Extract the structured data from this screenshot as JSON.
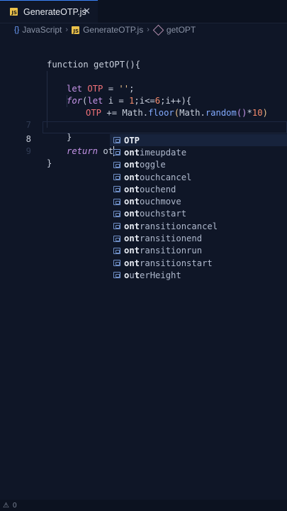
{
  "tab": {
    "label": "GenerateOTP.js",
    "badge": "JS",
    "close": "✕"
  },
  "breadcrumb": {
    "lang": "JavaScript",
    "file": "GenerateOTP.js",
    "symbol": "getOPT",
    "sep": "›"
  },
  "lines": [
    "7",
    "8",
    "9"
  ],
  "code": {
    "l2_kw": "function",
    "l2_fn": "getOPT",
    "l2_rest": "(){",
    "l4_kw": "let",
    "l4_var": "OTP",
    "l4_eq": " = ",
    "l4_str": "''",
    "l4_semi": ";",
    "l5_kw": "for",
    "l5_p1": "(",
    "l5_let": "let",
    "l5_p2": " i = ",
    "l5_n1": "1",
    "l5_p3": ";i<=",
    "l5_n2": "6",
    "l5_p4": ";i++){",
    "l6_var": "OTP",
    "l6_op": " += ",
    "l6_math1": "Math",
    "l6_dot1": ".",
    "l6_floor": "floor",
    "l6_paren": "(",
    "l6_math2": "Math",
    "l6_dot2": ".",
    "l6_random": "random",
    "l6_call": "()",
    "l6_times": "*",
    "l6_n": "10",
    "l6_close": ")",
    "l7_brace": "}",
    "l8_kw": "return",
    "l8_typed": " ot",
    "l9_brace": "}"
  },
  "suggestions": [
    {
      "match": "OTP",
      "rest": ""
    },
    {
      "match": "ont",
      "rest": "imeupdate"
    },
    {
      "match": "ont",
      "rest": "oggle"
    },
    {
      "match": "ont",
      "rest": "ouchcancel"
    },
    {
      "match": "ont",
      "rest": "ouchend"
    },
    {
      "match": "ont",
      "rest": "ouchmove"
    },
    {
      "match": "ont",
      "rest": "ouchstart"
    },
    {
      "match": "ont",
      "rest": "ransitioncancel"
    },
    {
      "match": "ont",
      "rest": "ransitionend"
    },
    {
      "match": "ont",
      "rest": "ransitionrun"
    },
    {
      "match": "ont",
      "rest": "ransitionstart"
    },
    {
      "match": "o",
      "mid": "u",
      "match2": "t",
      "rest": "erHeight"
    }
  ],
  "status": {
    "warn_icon": "⚠",
    "count": "0"
  },
  "colors": {
    "accent": "#3b82f6",
    "background": "#0f1627",
    "keyword": "#c594e8",
    "function": "#82aaff"
  }
}
